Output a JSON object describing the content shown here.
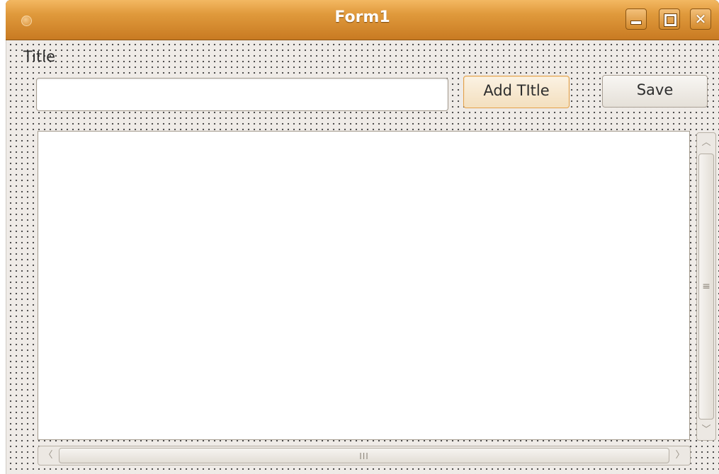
{
  "window": {
    "title": "Form1",
    "controls": {
      "minimize_icon": "minimize-icon",
      "maximize_icon": "maximize-icon",
      "close_icon": "close-icon",
      "close_glyph": "✕"
    },
    "accent_color": "#e09a3c"
  },
  "form": {
    "title_label": "Title",
    "title_input": {
      "value": "",
      "placeholder": ""
    },
    "add_title_button": "Add TItle",
    "save_button": "Save",
    "text_area": {
      "value": ""
    },
    "vertical_scrollbar": {
      "up_glyph": "︿",
      "down_glyph": "﹀",
      "grip_glyph": "≡"
    },
    "horizontal_scrollbar": {
      "left_glyph": "〈",
      "right_glyph": "〉",
      "grip_glyph": "III"
    }
  }
}
